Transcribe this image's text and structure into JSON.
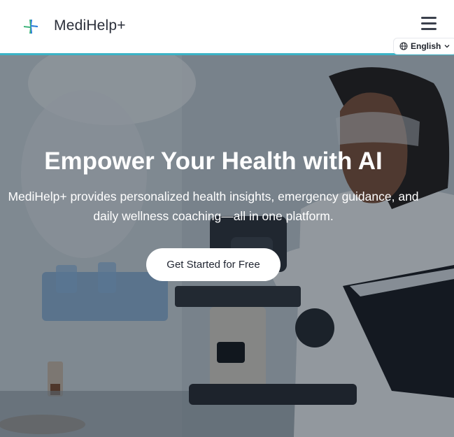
{
  "header": {
    "brand": "MediHelp+",
    "language": "English"
  },
  "hero": {
    "title": "Empower Your Health with AI",
    "subtitle": "MediHelp+ provides personalized health insights, emergency guidance, and daily wellness coaching—all in one platform.",
    "cta_label": "Get Started for Free"
  },
  "icons": {
    "logo": "medical-cross-icon",
    "menu": "hamburger-menu-icon",
    "language": "globe-icon",
    "dropdown": "chevron-down-icon"
  },
  "colors": {
    "accent": "#3bb3c6",
    "brand_green": "#3db37a",
    "brand_blue": "#2e7de0",
    "text_dark": "#2b2f3a"
  }
}
